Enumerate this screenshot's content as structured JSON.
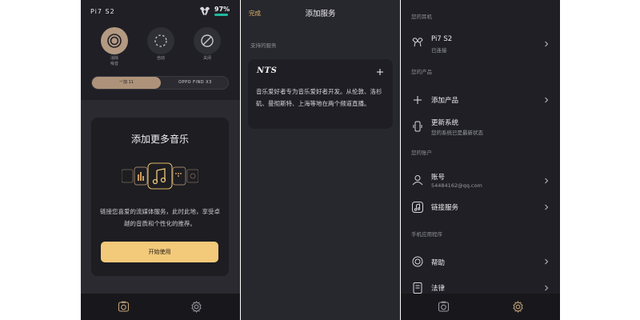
{
  "home": {
    "device_name": "Pi7 S2",
    "battery": "97%",
    "battery_level": 0.97,
    "modes": [
      {
        "label": "消除\n噪音",
        "icon": "noise-cancel-icon",
        "active": true
      },
      {
        "label": "自动",
        "icon": "auto-icon",
        "active": false
      },
      {
        "label": "关闭",
        "icon": "off-icon",
        "active": false
      }
    ],
    "segment": {
      "left": "一加 11",
      "right": "OPPO FIND X3"
    },
    "card": {
      "title": "添加更多音乐",
      "description": "链接您喜爱的流媒体服务，此时此地，享受卓越的音质和个性化的推荐。",
      "button": "开始使用"
    }
  },
  "services": {
    "done": "完成",
    "title": "添加服务",
    "section": "支持的服务",
    "service": {
      "logo": "NTS",
      "description": "音乐爱好者专为音乐爱好者开发。从伦敦、洛杉矶、曼彻斯特、上海等地在两个频道直播。"
    }
  },
  "settings": {
    "sections": {
      "earphones": "您的耳机",
      "products": "您的产品",
      "account": "您的账户",
      "app": "手机应用程序"
    },
    "rows": {
      "device": {
        "title": "Pi7 S2",
        "sub": "已连接"
      },
      "add_product": {
        "title": "添加产品"
      },
      "update": {
        "title": "更新系统",
        "sub": "您的系统已是最新状态"
      },
      "account": {
        "title": "账号",
        "sub": "54484162@qq.com"
      },
      "link_services": {
        "title": "链接服务"
      },
      "help": {
        "title": "帮助"
      },
      "legal": {
        "title": "法律"
      }
    }
  },
  "colors": {
    "accent": "#f3c97a",
    "accent_text": "#e0b866",
    "segment_active": "#ae937a",
    "battery": "#1fb99e",
    "background": "#1f1f25"
  },
  "tabbar": {
    "tabs": [
      {
        "icon": "headphones-tab-icon"
      },
      {
        "icon": "gear-icon"
      }
    ]
  }
}
